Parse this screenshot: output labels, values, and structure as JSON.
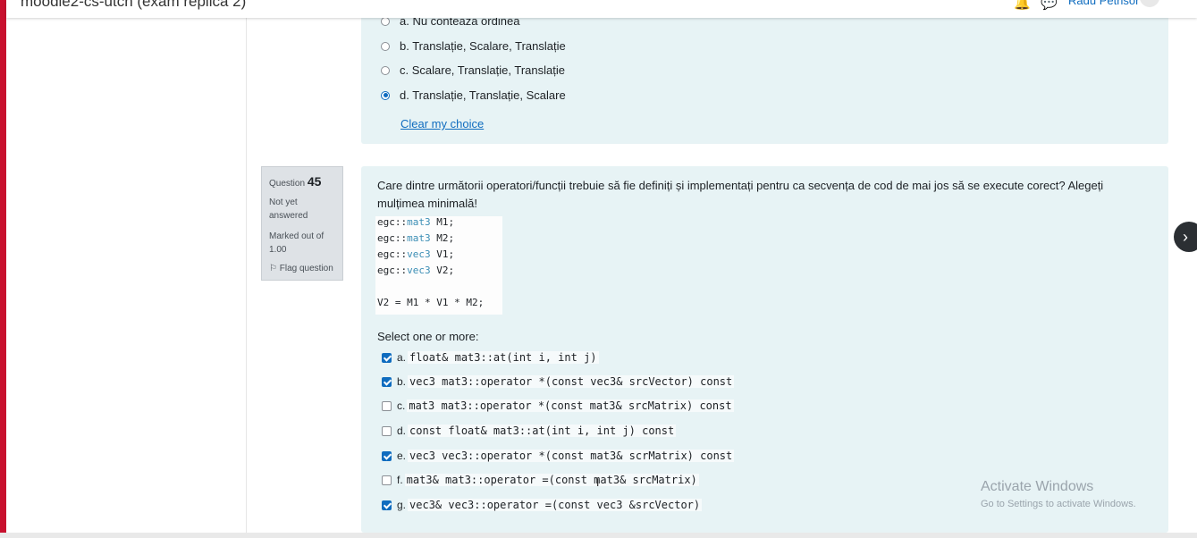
{
  "header": {
    "site_title": "moodle2-cs-utcn (exam replica 2)",
    "bell_icon": "bell-icon",
    "chat_icon": "chat-icon",
    "user_name": "Radu Petrisor"
  },
  "prev_question": {
    "options": [
      {
        "label": "a. Nu contează ordinea",
        "checked": false
      },
      {
        "label": "b. Translație, Scalare, Translație",
        "checked": false
      },
      {
        "label": "c. Scalare, Translație, Translație",
        "checked": false
      },
      {
        "label": "d. Translație, Translație, Scalare",
        "checked": true
      }
    ],
    "clear_choice": "Clear my choice"
  },
  "question": {
    "label": "Question",
    "number": "45",
    "state": "Not yet answered",
    "marks": "Marked out of 1.00",
    "flag": "Flag question",
    "text": "Care dintre următorii operatori/funcții trebuie să fie definiți și implementați pentru ca secvența de cod de mai jos să se execute corect? Alegeți mulțimea minimală!",
    "code": [
      {
        "ns": "egc::",
        "type": "mat3",
        "rest": " M1;"
      },
      {
        "ns": "egc::",
        "type": "mat3",
        "rest": " M2;"
      },
      {
        "ns": "egc::",
        "type": "vec3",
        "rest": " V1;"
      },
      {
        "ns": "egc::",
        "type": "vec3",
        "rest": " V2;"
      }
    ],
    "code_statement": "V2 = M1 * V1 * M2;",
    "prompt": "Select one or more:",
    "options": [
      {
        "letter": "a.",
        "code": "float& mat3::at(int i, int j)",
        "checked": true
      },
      {
        "letter": "b.",
        "code": "vec3 mat3::operator *(const vec3& srcVector) const",
        "checked": true
      },
      {
        "letter": "c.",
        "code": "mat3 mat3::operator *(const mat3& srcMatrix) const",
        "checked": false
      },
      {
        "letter": "d.",
        "code": "const float& mat3::at(int i, int j) const",
        "checked": false
      },
      {
        "letter": "e.",
        "code": "vec3 vec3::operator *(const mat3& scrMatrix) const",
        "checked": true
      },
      {
        "letter": "f.",
        "code": "mat3& mat3::operator =(const mat3& srcMatrix)",
        "checked": false
      },
      {
        "letter": "g.",
        "code": "vec3& vec3::operator =(const vec3 &srcVector)",
        "checked": true
      }
    ]
  },
  "watermark": {
    "title": "Activate Windows",
    "subtitle": "Go to Settings to activate Windows."
  },
  "next_button_glyph": "›"
}
